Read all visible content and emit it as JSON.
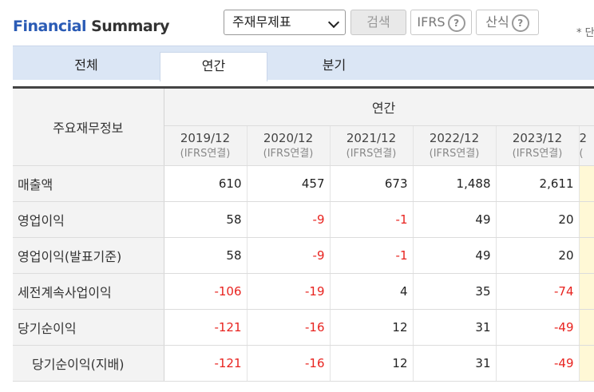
{
  "header": {
    "title_part1": "Financial",
    "title_part2": "Summary",
    "statement_select": "주재무제표",
    "search_label": "검색",
    "ifrs_label": "IFRS",
    "calc_label": "산식",
    "help_icon": "question-circle",
    "unit_note": "* 단"
  },
  "tabs": [
    "전체",
    "연간",
    "분기"
  ],
  "table": {
    "item_header": "주요재무정보",
    "group_header": "연간",
    "columns": [
      {
        "period": "2019/12",
        "basis": "(IFRS연결)"
      },
      {
        "period": "2020/12",
        "basis": "(IFRS연결)"
      },
      {
        "period": "2021/12",
        "basis": "(IFRS연결)"
      },
      {
        "period": "2022/12",
        "basis": "(IFRS연결)"
      },
      {
        "period": "2023/12",
        "basis": "(IFRS연결)"
      },
      {
        "period": "2",
        "basis": "("
      }
    ],
    "rows": [
      {
        "label": "매출액",
        "values": [
          "610",
          "457",
          "673",
          "1,488",
          "2,611"
        ]
      },
      {
        "label": "영업이익",
        "values": [
          "58",
          "-9",
          "-1",
          "49",
          "20"
        ]
      },
      {
        "label": "영업이익(발표기준)",
        "values": [
          "58",
          "-9",
          "-1",
          "49",
          "20"
        ]
      },
      {
        "label": "세전계속사업이익",
        "values": [
          "-106",
          "-19",
          "4",
          "35",
          "-74"
        ]
      },
      {
        "label": "당기순이익",
        "values": [
          "-121",
          "-16",
          "12",
          "31",
          "-49"
        ]
      },
      {
        "label": "당기순이익(지배)",
        "values": [
          "-121",
          "-16",
          "12",
          "31",
          "-49"
        ]
      }
    ]
  },
  "colors": {
    "brand_blue": "#2a5bb5",
    "negative_red": "#e8231f",
    "tab_bar": "#dbe6f5",
    "highlight_column": "#fff8d6"
  }
}
